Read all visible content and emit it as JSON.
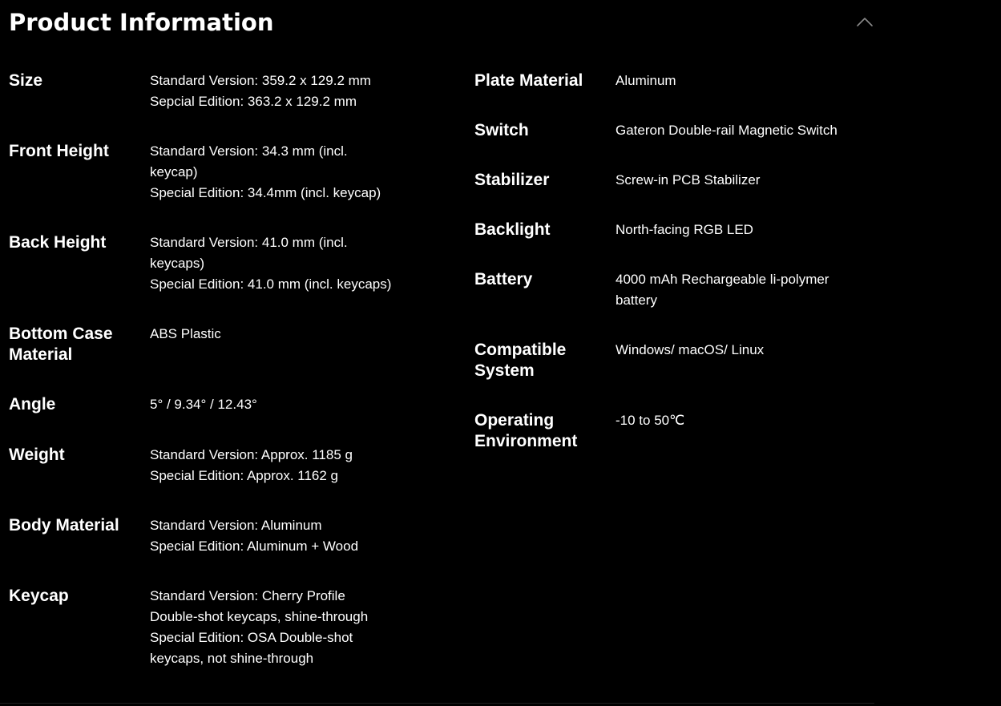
{
  "header": {
    "title": "Product Information",
    "collapse_icon": "chevron-up-icon"
  },
  "colors": {
    "background": "#000000",
    "text": "#ffffff",
    "icon": "#8a8a8a"
  },
  "specs_left": [
    {
      "label": "Size",
      "values": [
        "Standard Version: 359.2 x 129.2 mm",
        "Sepcial Edition: 363.2 x 129.2 mm"
      ]
    },
    {
      "label": "Front Height",
      "values": [
        "Standard Version: 34.3 mm (incl. keycap)",
        "Special Edition: 34.4mm (incl. keycap)"
      ]
    },
    {
      "label": "Back Height",
      "values": [
        "Standard Version: 41.0 mm (incl. keycaps)",
        "Special Edition: 41.0 mm (incl. keycaps)"
      ]
    },
    {
      "label": "Bottom Case Material",
      "values": [
        "ABS Plastic"
      ]
    },
    {
      "label": "Angle",
      "values": [
        "5° / 9.34° / 12.43°"
      ]
    },
    {
      "label": "Weight",
      "values": [
        "Standard Version: Approx. 1185 g",
        "Special Edition: Approx. 1162 g"
      ]
    },
    {
      "label": "Body Material",
      "values": [
        "Standard Version: Aluminum",
        "Special Edition: Aluminum + Wood"
      ]
    },
    {
      "label": "Keycap",
      "values": [
        "Standard Version: Cherry Profile Double-shot keycaps, shine-through",
        "Special Edition: OSA Double-shot keycaps, not shine-through"
      ]
    }
  ],
  "specs_right": [
    {
      "label": "Plate Material",
      "values": [
        "Aluminum"
      ]
    },
    {
      "label": "Switch",
      "values": [
        "Gateron Double-rail Magnetic Switch"
      ]
    },
    {
      "label": "Stabilizer",
      "values": [
        "Screw-in PCB Stabilizer"
      ]
    },
    {
      "label": "Backlight",
      "values": [
        "North-facing RGB LED"
      ]
    },
    {
      "label": "Battery",
      "values": [
        "4000 mAh Rechargeable li-polymer battery"
      ]
    },
    {
      "label": "Compatible System",
      "values": [
        "Windows/ macOS/ Linux"
      ]
    },
    {
      "label": "Operating Environment",
      "values": [
        "-10 to 50℃"
      ]
    }
  ]
}
